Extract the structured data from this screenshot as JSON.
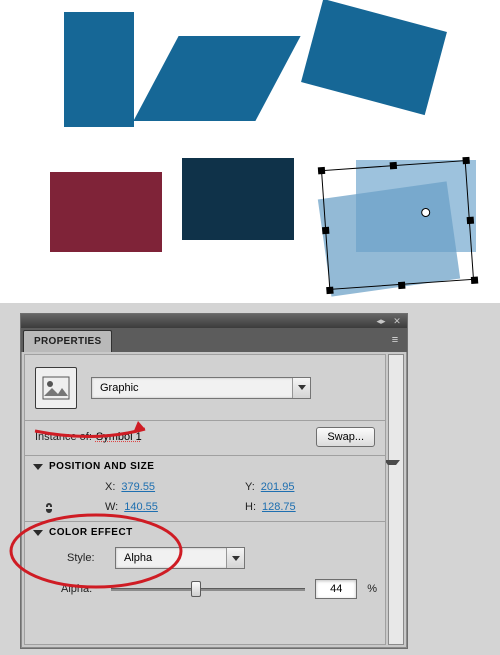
{
  "panel": {
    "title": "PROPERTIES",
    "instance_type_options_selected": "Graphic",
    "instance_of_label": "Instance of:",
    "instance_name": "Symbol 1",
    "swap_label": "Swap..."
  },
  "position_size": {
    "header": "POSITION AND SIZE",
    "x_label": "X:",
    "x_value": "379.55",
    "y_label": "Y:",
    "y_value": "201.95",
    "w_label": "W:",
    "w_value": "140.55",
    "h_label": "H:",
    "h_value": "128.75"
  },
  "color_effect": {
    "header": "COLOR EFFECT",
    "style_label": "Style:",
    "style_value": "Alpha",
    "alpha_label": "Alpha:",
    "alpha_value": "44",
    "percent": "%"
  },
  "icons": {
    "menu": "≡",
    "close": "✕",
    "dock": "◂▸"
  }
}
